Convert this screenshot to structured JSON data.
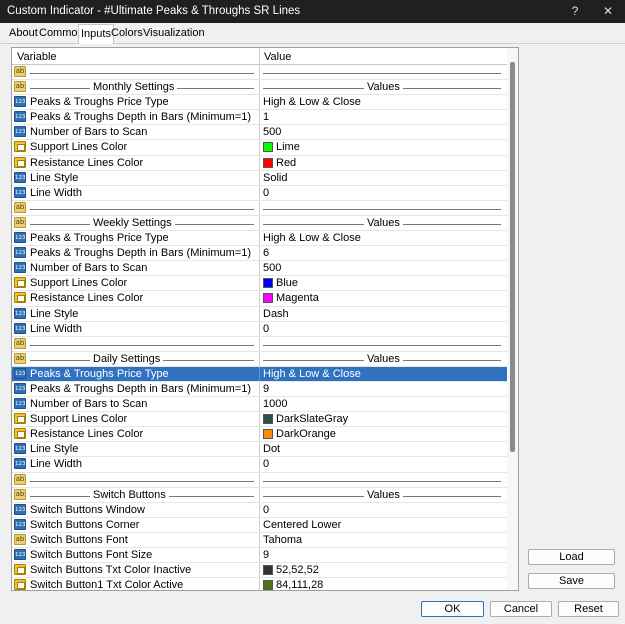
{
  "window": {
    "title": "Custom Indicator - #Ultimate Peaks & Throughs SR Lines",
    "help": "?",
    "close": "✕"
  },
  "tabs": [
    "About",
    "Common",
    "Inputs",
    "Colors",
    "Visualization"
  ],
  "grid": {
    "col_variable": "Variable",
    "col_value": "Value",
    "rows": [
      {
        "type": "blank",
        "icon": "ab"
      },
      {
        "type": "section",
        "icon": "ab",
        "name": "Monthly Settings",
        "value": "Values"
      },
      {
        "type": "num",
        "name": "Peaks & Troughs Price Type",
        "value": "High & Low & Close"
      },
      {
        "type": "num",
        "name": "Peaks & Troughs Depth in Bars (Minimum=1)",
        "value": "1"
      },
      {
        "type": "num",
        "name": "Number of Bars to Scan",
        "value": "500"
      },
      {
        "type": "col",
        "name": "Support Lines Color",
        "value": "Lime",
        "color": "#00ff00"
      },
      {
        "type": "col",
        "name": "Resistance Lines Color",
        "value": "Red",
        "color": "#ff0000"
      },
      {
        "type": "num",
        "name": "Line Style",
        "value": "Solid"
      },
      {
        "type": "num",
        "name": "Line Width",
        "value": "0"
      },
      {
        "type": "blank",
        "icon": "ab"
      },
      {
        "type": "section",
        "icon": "ab",
        "name": "Weekly Settings",
        "value": "Values"
      },
      {
        "type": "num",
        "name": "Peaks & Troughs Price Type",
        "value": "High & Low & Close"
      },
      {
        "type": "num",
        "name": "Peaks & Troughs Depth in Bars (Minimum=1)",
        "value": "6"
      },
      {
        "type": "num",
        "name": "Number of Bars to Scan",
        "value": "500"
      },
      {
        "type": "col",
        "name": "Support Lines Color",
        "value": "Blue",
        "color": "#0000ff"
      },
      {
        "type": "col",
        "name": "Resistance Lines Color",
        "value": "Magenta",
        "color": "#ff00ff"
      },
      {
        "type": "num",
        "name": "Line Style",
        "value": "Dash"
      },
      {
        "type": "num",
        "name": "Line Width",
        "value": "0"
      },
      {
        "type": "blank",
        "icon": "ab"
      },
      {
        "type": "section",
        "icon": "ab",
        "name": "Daily Settings",
        "value": "Values"
      },
      {
        "type": "num",
        "name": "Peaks & Troughs Price Type",
        "value": "High & Low & Close",
        "selected": true
      },
      {
        "type": "num",
        "name": "Peaks & Troughs Depth in Bars (Minimum=1)",
        "value": "9"
      },
      {
        "type": "num",
        "name": "Number of Bars to Scan",
        "value": "1000"
      },
      {
        "type": "col",
        "name": "Support Lines Color",
        "value": "DarkSlateGray",
        "color": "#2f4f4f"
      },
      {
        "type": "col",
        "name": "Resistance Lines Color",
        "value": "DarkOrange",
        "color": "#ff8c00"
      },
      {
        "type": "num",
        "name": "Line Style",
        "value": "Dot"
      },
      {
        "type": "num",
        "name": "Line Width",
        "value": "0"
      },
      {
        "type": "blank",
        "icon": "ab"
      },
      {
        "type": "section",
        "icon": "ab",
        "name": "Switch Buttons",
        "value": "Values"
      },
      {
        "type": "num",
        "name": "Switch Buttons Window",
        "value": "0"
      },
      {
        "type": "num",
        "name": "Switch Buttons Corner",
        "value": "Centered Lower"
      },
      {
        "type": "ab",
        "name": "Switch Buttons Font",
        "value": "Tahoma"
      },
      {
        "type": "num",
        "name": "Switch Buttons Font Size",
        "value": "9"
      },
      {
        "type": "col",
        "name": "Switch Buttons Txt Color Inactive",
        "value": "52,52,52",
        "color": "#343434"
      },
      {
        "type": "col",
        "name": "Switch Button1 Txt Color Active",
        "value": "84,111,28",
        "color": "#546f1c"
      }
    ]
  },
  "side_buttons": {
    "load": "Load",
    "save": "Save"
  },
  "footer": {
    "ok": "OK",
    "cancel": "Cancel",
    "reset": "Reset"
  }
}
